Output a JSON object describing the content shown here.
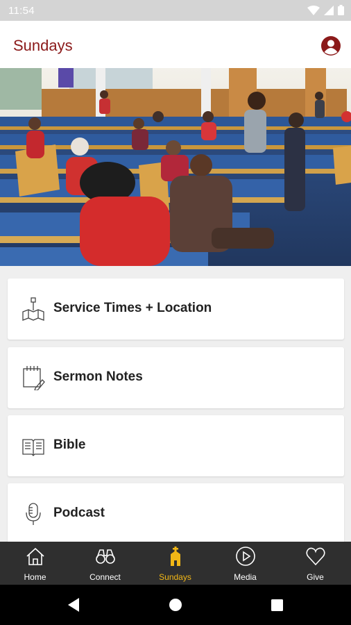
{
  "status_bar": {
    "time": "11:54"
  },
  "app_bar": {
    "title": "Sundays"
  },
  "cards": [
    {
      "label": "Service Times + Location",
      "icon": "map-location-icon"
    },
    {
      "label": "Sermon Notes",
      "icon": "notepad-pen-icon"
    },
    {
      "label": "Bible",
      "icon": "open-book-icon"
    },
    {
      "label": "Podcast",
      "icon": "microphone-icon"
    }
  ],
  "bottom_nav": [
    {
      "label": "Home",
      "icon": "home-icon",
      "active": false
    },
    {
      "label": "Connect",
      "icon": "binoculars-icon",
      "active": false
    },
    {
      "label": "Sundays",
      "icon": "church-icon",
      "active": true
    },
    {
      "label": "Media",
      "icon": "play-circle-icon",
      "active": false
    },
    {
      "label": "Give",
      "icon": "heart-icon",
      "active": false
    }
  ],
  "colors": {
    "brand": "#8b1a1a",
    "active_tab": "#f2b716",
    "nav_bg": "#2f2f2f"
  }
}
